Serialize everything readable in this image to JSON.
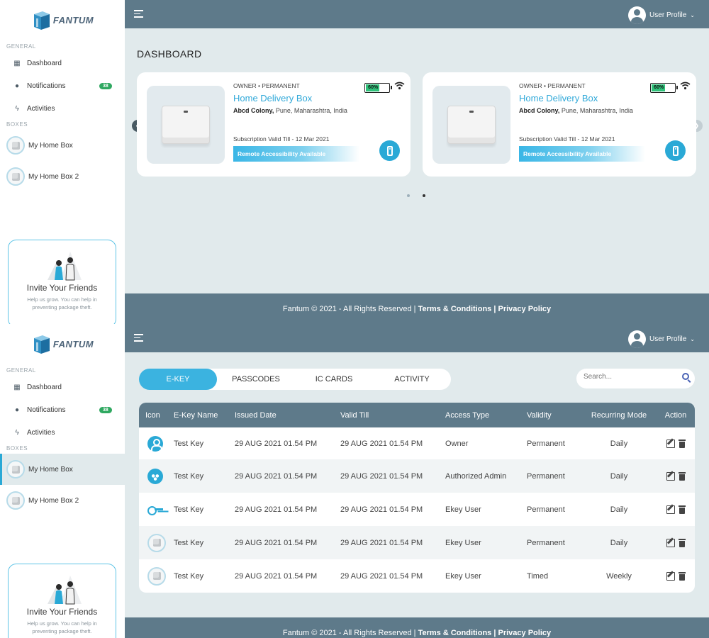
{
  "brand": {
    "name": "FANTUM"
  },
  "sidebar": {
    "section_general": "GENERAL",
    "section_boxes": "BOXES",
    "nav": [
      {
        "label": "Dashboard",
        "icon": "dashboard-icon"
      },
      {
        "label": "Notifications",
        "icon": "bell-icon",
        "badge": "38"
      },
      {
        "label": "Activities",
        "icon": "bolt-icon"
      }
    ],
    "boxes": [
      {
        "label": "My Home Box"
      },
      {
        "label": "My Home Box 2"
      }
    ],
    "invite": {
      "title": "Invite Your Friends",
      "subtitle": "Help us grow. You can help in preventing package theft."
    }
  },
  "header": {
    "profile_label": "User Profile"
  },
  "footer": {
    "copyright": "Fantum © 2021 - All Rights Reserved |",
    "terms": "Terms & Conditions",
    "sep": "|",
    "privacy": "Privacy Policy"
  },
  "dashboard": {
    "title": "DASHBOARD",
    "cards": [
      {
        "owner": "OWNER • PERMANENT",
        "title": "Home Delivery Box",
        "address_bold": "Abcd Colony,",
        "address_rest": "Pune, Maharashtra, India",
        "subscription": "Subscription Valid Till - 12 Mar 2021",
        "remote": "Remote Accessibility Available",
        "battery": "60%",
        "battery_level": 0.6
      },
      {
        "owner": "OWNER • PERMANENT",
        "title": "Home Delivery Box",
        "address_bold": "Abcd Colony,",
        "address_rest": "Pune, Maharashtra, India",
        "subscription": "Subscription Valid Till - 12 Mar 2021",
        "remote": "Remote Accessibility Available",
        "battery": "60%",
        "battery_level": 0.6
      }
    ],
    "carousel_active_index": 1
  },
  "keys_page": {
    "tabs": [
      "E-KEY",
      "PASSCODES",
      "IC CARDS",
      "ACTIVITY"
    ],
    "active_tab": 0,
    "search_placeholder": "Search...",
    "columns": [
      "Icon",
      "E-Key Name",
      "Issued Date",
      "Valid Till",
      "Access Type",
      "Validity",
      "Recurring Mode",
      "Action"
    ],
    "rows": [
      {
        "icon": "user-icon",
        "name": "Test Key",
        "issued": "29 AUG 2021 01.54 PM",
        "valid": "29 AUG 2021 01.54 PM",
        "access": "Owner",
        "validity": "Permanent",
        "recurring": "Daily"
      },
      {
        "icon": "admin-group-icon",
        "name": "Test Key",
        "issued": "29 AUG 2021 01.54 PM",
        "valid": "29 AUG 2021 01.54 PM",
        "access": "Authorized Admin",
        "validity": "Permanent",
        "recurring": "Daily"
      },
      {
        "icon": "key-icon",
        "name": "Test Key",
        "issued": "29 AUG 2021 01.54 PM",
        "valid": "29 AUG 2021 01.54 PM",
        "access": "Ekey User",
        "validity": "Permanent",
        "recurring": "Daily"
      },
      {
        "icon": "box-icon",
        "name": "Test Key",
        "issued": "29 AUG 2021 01.54 PM",
        "valid": "29 AUG 2021 01.54 PM",
        "access": "Ekey User",
        "validity": "Permanent",
        "recurring": "Daily"
      },
      {
        "icon": "box-icon",
        "name": "Test Key",
        "issued": "29 AUG 2021 01.54 PM",
        "valid": "29 AUG 2021 01.54 PM",
        "access": "Ekey User",
        "validity": "Timed",
        "recurring": "Weekly"
      }
    ]
  },
  "colors": {
    "accent": "#2aa9d6",
    "header": "#5e7a8a",
    "background": "#e1eaec",
    "badge": "#2fa860",
    "battery": "#2fc27a"
  }
}
